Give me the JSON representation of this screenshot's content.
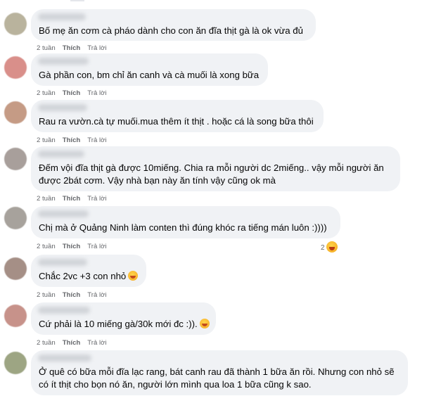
{
  "comments": [
    {
      "text_lines": [
        "Bố mẹ ăn cơm cà pháo dành cho con ăn đĩa thịt gà là ok vừa đủ"
      ],
      "time": "2 tuần",
      "like": "Thích",
      "reply": "Trả lời",
      "avatar_color": "#b9b39d"
    },
    {
      "text_lines": [
        "Gà phần con, bm chỉ ăn canh và cà muối là xong bữa"
      ],
      "time": "2 tuần",
      "like": "Thích",
      "reply": "Trả lời",
      "avatar_color": "#d98f8a"
    },
    {
      "text_lines": [
        "Rau ra vườn.cà tự muối.mua thêm ít thịt . hoặc cá là song bữa thôi"
      ],
      "time": "2 tuần",
      "like": "Thích",
      "reply": "Trả lời",
      "avatar_color": "#c59b85"
    },
    {
      "text_lines": [
        "Đếm vội đĩa thịt gà được 10miếng. Chia ra mỗi người dc 2miếng.. vậy mỗi người ăn",
        "được 2bát cơm. Vậy nhà bạn này ăn tính vậy cũng ok mà"
      ],
      "time": "2 tuần",
      "like": "Thích",
      "reply": "Trả lời",
      "avatar_color": "#a89f9b"
    },
    {
      "text_lines": [
        "Chị mà ở Quảng Ninh làm conten thì đúng khóc ra tiếng mán luôn :))))"
      ],
      "time": "2 tuần",
      "like": "Thích",
      "reply": "Trả lời",
      "avatar_color": "#a7a29c",
      "reaction_count": "2"
    },
    {
      "text_lines": [
        "Chắc 2vc +3 con nhỏ"
      ],
      "time": "2 tuần",
      "like": "Thích",
      "reply": "Trả lời",
      "avatar_color": "#a58f86",
      "trailing_emoji": "smile-emoji"
    },
    {
      "text_lines": [
        "Cứ phải là 10 miếng gà/30k mới đc :))."
      ],
      "time": "2 tuần",
      "like": "Thích",
      "reply": "Trả lời",
      "avatar_color": "#c7928a",
      "trailing_emoji": "tongue-emoji"
    },
    {
      "text_lines": [
        "Ở quê có bữa mỗi đĩa lạc rang, bát canh rau đã thành 1 bữa ăn rồi. Nhưng con nhỏ sẽ",
        "có ít thịt cho bọn nó ăn, người lớn mình qua loa 1 bữa cũng k sao."
      ],
      "time": "",
      "like": "",
      "reply": "",
      "avatar_color": "#9da583"
    }
  ]
}
